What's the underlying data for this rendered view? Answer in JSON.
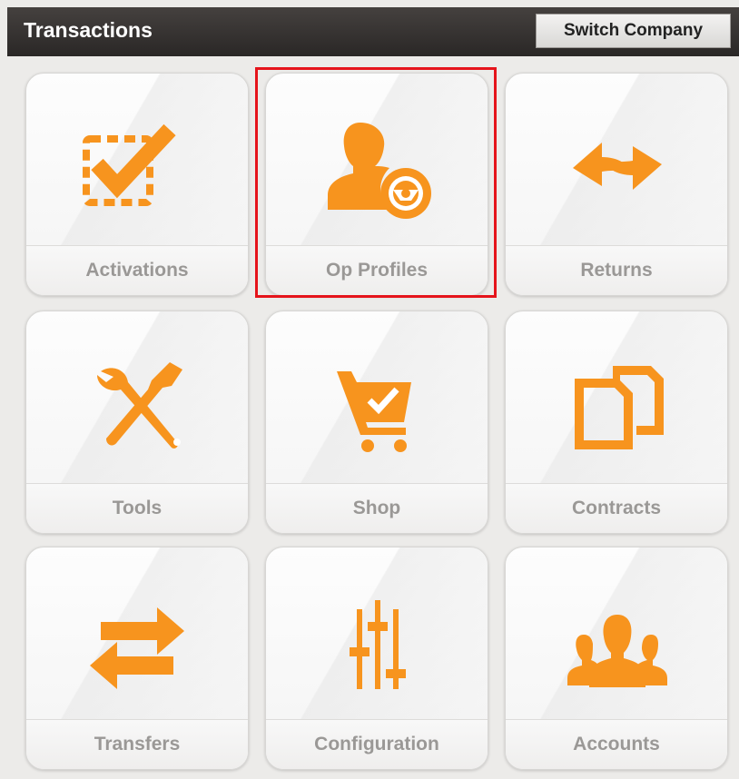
{
  "header": {
    "title": "Transactions",
    "switch_label": "Switch Company"
  },
  "colors": {
    "accent": "#f7941e",
    "highlight": "#e5141b",
    "header_bg": "#2f2b2a"
  },
  "tiles": [
    {
      "label": "Activations",
      "icon": "checkbox-icon"
    },
    {
      "label": "Op Profiles",
      "icon": "operator-profile-icon",
      "selected": true
    },
    {
      "label": "Returns",
      "icon": "return-arrows-icon"
    },
    {
      "label": "Tools",
      "icon": "tools-icon"
    },
    {
      "label": "Shop",
      "icon": "shopping-cart-icon"
    },
    {
      "label": "Contracts",
      "icon": "documents-icon"
    },
    {
      "label": "Transfers",
      "icon": "transfer-arrows-icon"
    },
    {
      "label": "Configuration",
      "icon": "sliders-icon"
    },
    {
      "label": "Accounts",
      "icon": "users-group-icon"
    }
  ]
}
